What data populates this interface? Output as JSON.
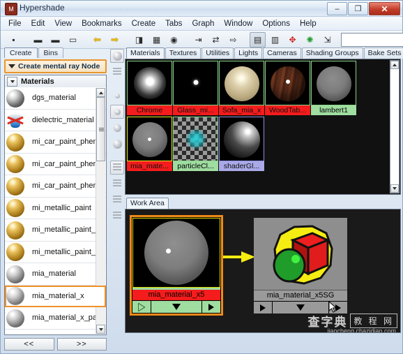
{
  "window": {
    "title": "Hypershade",
    "app_icon": "maya-icon",
    "minimize": "–",
    "maximize": "❐",
    "close": "✕"
  },
  "menubar": {
    "items": [
      "File",
      "Edit",
      "View",
      "Bookmarks",
      "Create",
      "Tabs",
      "Graph",
      "Window",
      "Options",
      "Help"
    ]
  },
  "toolbar": {
    "groups": [
      {
        "buttons": [
          {
            "name": "show-top-bottom-icon",
            "glyph": "▪"
          }
        ]
      },
      {
        "buttons": [
          {
            "name": "layout-both-icon",
            "glyph": "▬"
          },
          {
            "name": "layout-top-only-icon",
            "glyph": "▬"
          },
          {
            "name": "layout-bottom-only-icon",
            "glyph": "▭"
          }
        ]
      },
      {
        "buttons": [
          {
            "name": "back-arrow-icon",
            "glyph": "⬅"
          },
          {
            "name": "forward-arrow-icon",
            "glyph": "➡"
          }
        ]
      },
      {
        "buttons": [
          {
            "name": "clear-graph-eraser-icon",
            "glyph": "◨"
          },
          {
            "name": "rearrange-graph-icon",
            "glyph": "▦"
          },
          {
            "name": "show-network-icon",
            "glyph": "◉"
          }
        ]
      },
      {
        "buttons": [
          {
            "name": "input-connections-icon",
            "glyph": "⇥"
          },
          {
            "name": "input-output-connections-icon",
            "glyph": "⇄"
          },
          {
            "name": "output-connections-icon",
            "glyph": "⇨"
          }
        ]
      },
      {
        "buttons": [
          {
            "name": "graph-add-selected-icon",
            "glyph": "▤"
          },
          {
            "name": "graph-remove-selected-icon",
            "glyph": "▥"
          },
          {
            "name": "render-swatch-icon",
            "glyph": "✥"
          },
          {
            "name": "refresh-swatch-icon",
            "glyph": "✺"
          },
          {
            "name": "expand-nodes-icon",
            "glyph": "⇲"
          }
        ]
      }
    ],
    "search_value": ""
  },
  "left_panel": {
    "tabs": [
      {
        "label": "Create",
        "selected": true
      },
      {
        "label": "Bins",
        "selected": false
      }
    ],
    "section_header": {
      "label": "Create mental ray Node",
      "expander": "triangle-down-icon",
      "highlight_color": "#e8952b"
    },
    "list_header": {
      "label": "Materials",
      "expander": "triangle-down-icon"
    },
    "items": [
      {
        "label": "dgs_material",
        "swatch": "silver",
        "selected": false
      },
      {
        "label": "dielectric_material",
        "swatch": "dielectric",
        "selected": false
      },
      {
        "label": "mi_car_paint_phen",
        "swatch": "gold",
        "selected": false
      },
      {
        "label": "mi_car_paint_phen_",
        "swatch": "gold",
        "selected": false
      },
      {
        "label": "mi_car_paint_phen_",
        "swatch": "gold",
        "selected": false
      },
      {
        "label": "mi_metallic_paint",
        "swatch": "gold",
        "selected": false
      },
      {
        "label": "mi_metallic_paint_x",
        "swatch": "gold",
        "selected": false
      },
      {
        "label": "mi_metallic_paint_x_",
        "swatch": "gold",
        "selected": false
      },
      {
        "label": "mia_material",
        "swatch": "grey",
        "selected": false
      },
      {
        "label": "mia_material_x",
        "swatch": "dotted",
        "selected": true
      },
      {
        "label": "mia_material_x_pass",
        "swatch": "grey",
        "selected": false
      },
      {
        "label": "",
        "swatch": "half",
        "selected": false
      }
    ],
    "footer_buttons": [
      {
        "label": "<<",
        "name": "prev-page-button"
      },
      {
        "label": ">>",
        "name": "next-page-button"
      }
    ]
  },
  "icon_strip": {
    "items": [
      {
        "name": "swatch-display-icon",
        "active": true
      },
      {
        "name": "list-display-icon",
        "active": false
      },
      {
        "name": "small-swatch-size-icon",
        "active": false
      },
      {
        "name": "medium-swatch-size-icon",
        "active": true
      },
      {
        "name": "large-swatch-size-icon",
        "active": false
      },
      {
        "name": "xlarge-swatch-size-icon",
        "active": false
      },
      {
        "name": "sort-alphabetical-icon",
        "active": true
      },
      {
        "name": "sort-by-type-icon",
        "active": false
      },
      {
        "name": "sort-by-time-icon",
        "active": false
      },
      {
        "name": "sort-reverse-icon",
        "active": false
      }
    ]
  },
  "right_panel": {
    "top_tabs": [
      {
        "label": "Materials",
        "selected": true
      },
      {
        "label": "Textures",
        "selected": false
      },
      {
        "label": "Utilities",
        "selected": false
      },
      {
        "label": "Lights",
        "selected": false
      },
      {
        "label": "Cameras",
        "selected": false
      },
      {
        "label": "Shading Groups",
        "selected": false
      },
      {
        "label": "Bake Sets",
        "selected": false
      }
    ],
    "tab_nav": {
      "prev": "tab-scroll-left-icon",
      "next": "tab-scroll-right-icon"
    },
    "swatches": [
      {
        "label": "Chrome",
        "style": "r",
        "art": "dark-highlight"
      },
      {
        "label": "Glass_mi...",
        "style": "r",
        "art": "tiny-dot"
      },
      {
        "label": "Sofa_mia_x",
        "style": "r",
        "art": "tan-sphere"
      },
      {
        "label": "WoodTab...",
        "style": "r",
        "art": "wood-sphere"
      },
      {
        "label": "lambert1",
        "style": "g",
        "art": "grey-sphere"
      },
      {
        "label": "mia_mate...",
        "style": "y",
        "art": "grey-sphere-dot"
      },
      {
        "label": "particleCl...",
        "style": "g",
        "art": "checker-teal"
      },
      {
        "label": "shaderGl...",
        "style": "p",
        "art": "dark-glossy"
      }
    ],
    "work_area_tabs": [
      {
        "label": "Work Area",
        "selected": true
      }
    ],
    "nodes": [
      {
        "name": "mia_material_x5",
        "title": "mia_material_x5",
        "selected": true,
        "title_color": "#f41c1c",
        "footer_color": "#9fdda0",
        "footer_buttons": [
          "input-arrow-icon",
          "expand-arrow-icon",
          "output-arrow-icon"
        ]
      },
      {
        "name": "mia_material_x5SG",
        "title": "mia_material_x5SG",
        "selected": false,
        "title_color": "#9a9a9a",
        "footer_color": "#9a9a9a",
        "footer_buttons": [
          "input-arrow-icon",
          "expand-arrow-icon",
          "output-arrow-icon"
        ]
      }
    ],
    "connection": {
      "name": "connection-arrow",
      "color": "#f5ec12"
    }
  },
  "watermark": {
    "main": "查字典",
    "badge": "教 程 网",
    "url": "jiaocheng.chazidian.com"
  }
}
